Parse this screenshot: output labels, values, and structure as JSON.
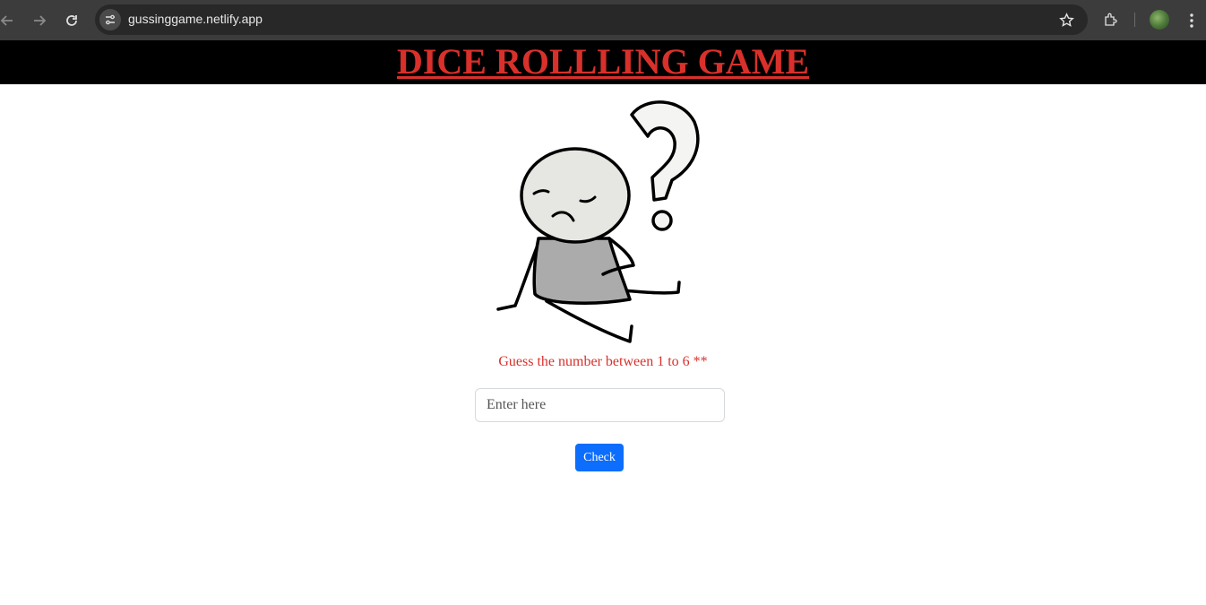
{
  "browser": {
    "url": "gussinggame.netlify.app",
    "icons": [
      "back-arrow-icon",
      "forward-arrow-icon",
      "reload-icon",
      "site-info-icon",
      "star-icon",
      "extensions-icon",
      "profile-avatar",
      "more-menu-icon"
    ]
  },
  "header": {
    "title": "DICE ROLLLING GAME",
    "title_color": "#d9302b",
    "background": "#000000"
  },
  "main": {
    "prompt": "Guess the number between 1 to 6 **",
    "input": {
      "placeholder": "Enter here",
      "value": ""
    },
    "check_label": "Check",
    "button_color": "#0d6efd"
  }
}
